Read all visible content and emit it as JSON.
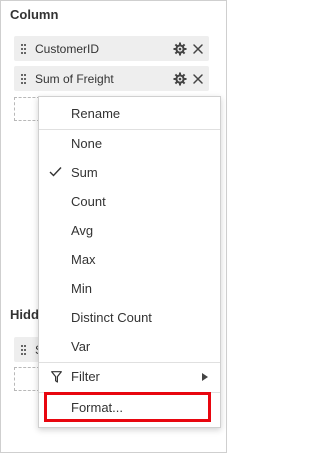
{
  "panel": {
    "column_section": {
      "title": "Column",
      "chips": [
        {
          "label": "CustomerID"
        },
        {
          "label": "Sum of Freight"
        }
      ]
    },
    "hidden_section": {
      "title": "Hidd",
      "chip_fragment": "S"
    }
  },
  "context_menu": {
    "items": [
      {
        "label": "Rename"
      },
      {
        "label": "None"
      },
      {
        "label": "Sum",
        "checked": true
      },
      {
        "label": "Count"
      },
      {
        "label": "Avg"
      },
      {
        "label": "Max"
      },
      {
        "label": "Min"
      },
      {
        "label": "Distinct Count"
      },
      {
        "label": "Var"
      },
      {
        "label": "Filter",
        "icon": "filter-icon",
        "has_submenu": true
      },
      {
        "label": "Format..."
      }
    ]
  },
  "colors": {
    "highlight": "#e8060f",
    "chip_background": "#eeeeee"
  }
}
